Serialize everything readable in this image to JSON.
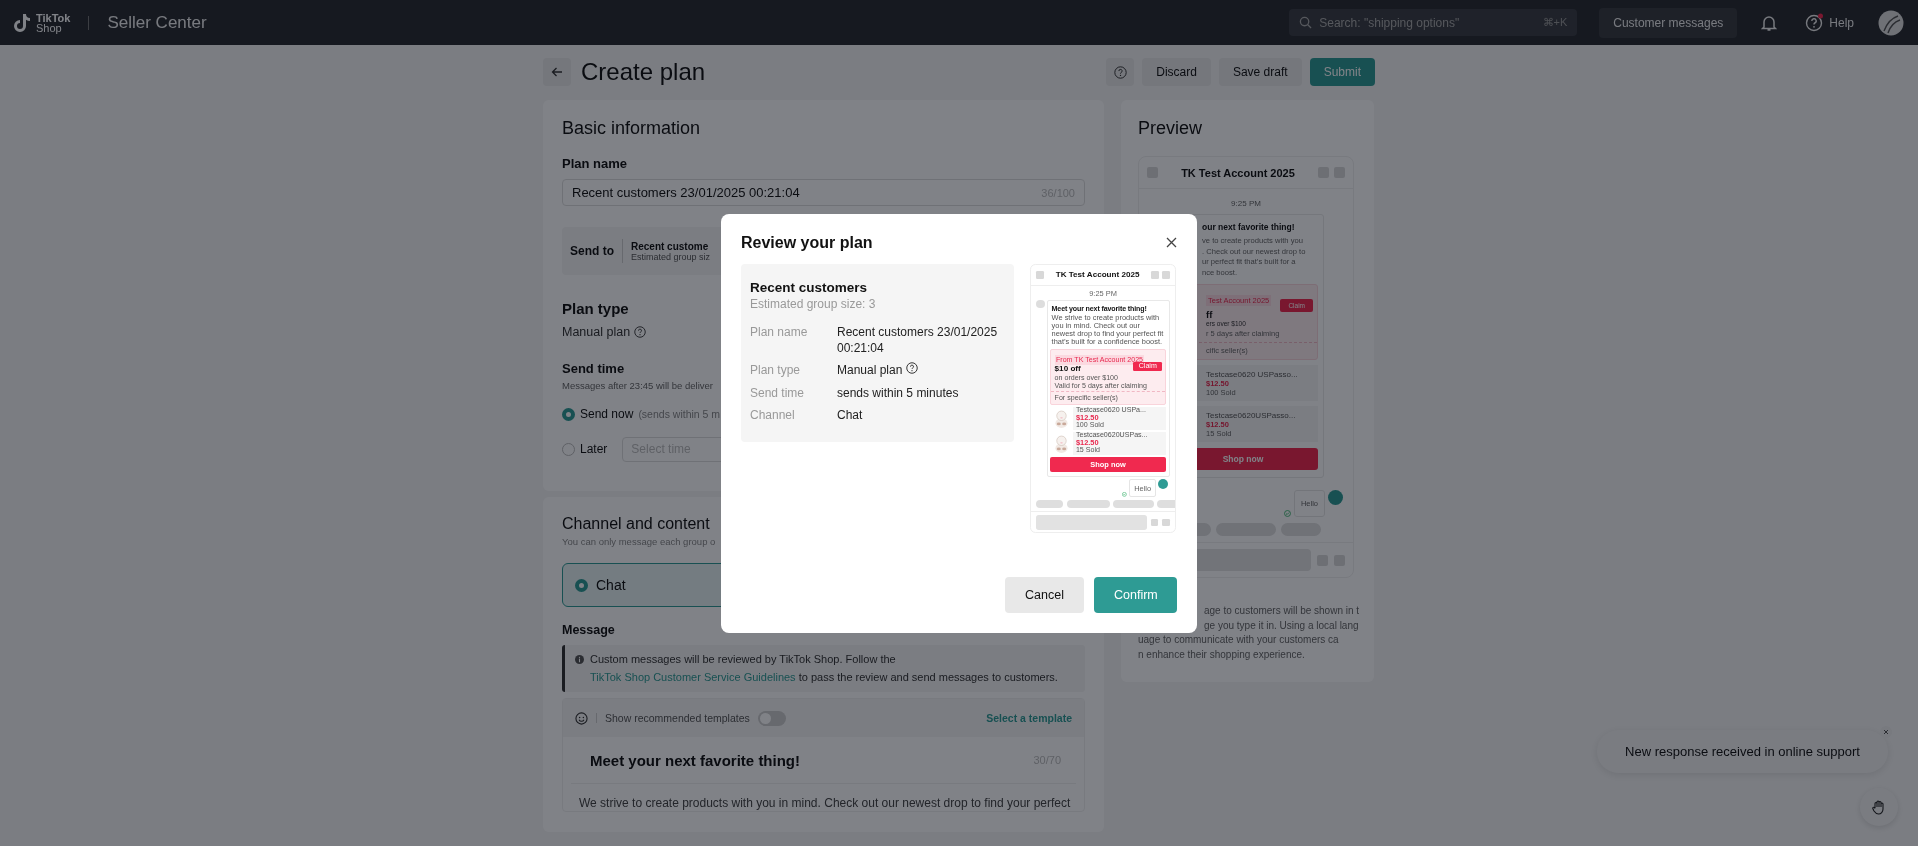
{
  "topbar": {
    "logo_line1": "TikTok",
    "logo_line2": "Shop",
    "title": "Seller Center",
    "search": {
      "placeholder": "Search: \"shipping options\"",
      "shortcut": "⌘+K"
    },
    "messages_button": "Customer messages",
    "help": "Help"
  },
  "page": {
    "title": "Create plan",
    "buttons": [
      {
        "label": "Discard",
        "kind": "secondary"
      },
      {
        "label": "Save draft",
        "kind": "secondary"
      },
      {
        "label": "Submit",
        "kind": "primary"
      }
    ]
  },
  "basic": {
    "title": "Basic information",
    "plan_name": {
      "label": "Plan name",
      "value": "Recent customers 23/01/2025 00:21:04",
      "counter": "36/100"
    },
    "send_to": {
      "label": "Send to",
      "group": "Recent custome",
      "size": "Estimated group siz"
    },
    "plan_type": {
      "title": "Plan type",
      "value": "Manual plan"
    },
    "send_time": {
      "title": "Send time",
      "note": "Messages after 23:45 will be deliver",
      "options": [
        {
          "label": "Send now",
          "hint": "(sends within 5 m",
          "selected": true
        },
        {
          "label": "Later",
          "placeholder": "Select time",
          "selected": false
        }
      ]
    }
  },
  "channel": {
    "title": "Channel and content",
    "subtitle": "You can only message each group o",
    "options": [
      {
        "label": "Chat",
        "selected": true
      }
    ],
    "message_label": "Message",
    "notice": "Custom messages will be reviewed by TikTok Shop. Follow the",
    "notice_link": "TikTok Shop Customer Service Guidelines",
    "notice_end": "to pass the review and send messages to customers.",
    "templates_label": "Show recommended templates",
    "templates_on": false,
    "select_template": "Select a template",
    "message_title": "Meet your next favorite thing!",
    "title_counter": "30/70",
    "body": "We strive to create products with you in mind. Check out our newest drop to find your perfect"
  },
  "preview": {
    "title": "Preview",
    "phone": {
      "header": "TK Test Account 2025",
      "time": "9:25 PM",
      "bubble_title": "our next favorite thing!",
      "body_lines": [
        "ve to create products with you",
        ". Check out our newest drop to",
        "ur perfect fit that’s built for a",
        "nce boost."
      ],
      "coupon": {
        "tag": "Test Account 2025",
        "amount": "ff",
        "condition": "ers over $100",
        "validity": "r 5 days after claiming",
        "scope": "cific seller(s)",
        "claim": "Claim"
      },
      "products": [
        {
          "name": "Testcase0620 USPasso...",
          "price": "$12.50",
          "sold": "100 Sold"
        },
        {
          "name": "Testcase0620USPasso...",
          "price": "$12.50",
          "sold": "15 Sold"
        }
      ],
      "cta": "Shop now",
      "reply": "Hello"
    },
    "note_lines": [
      "age to customers will be shown in t",
      "ge you type it in. Using a local lang",
      "uage to communicate with your customers ca",
      "n enhance their shopping experience."
    ]
  },
  "modal": {
    "title": "Review your plan",
    "group": "Recent customers",
    "size": "Estimated group size: 3",
    "rows": [
      {
        "label": "Plan name",
        "value": "Recent customers 23/01/2025 00:21:04",
        "kind": "text"
      },
      {
        "label": "Plan type",
        "value": "Manual plan",
        "kind": "help"
      },
      {
        "label": "Send time",
        "value": "sends within 5 minutes",
        "kind": "text"
      },
      {
        "label": "Channel",
        "value": "Chat",
        "kind": "text"
      }
    ],
    "phone": {
      "header": "TK Test Account 2025",
      "time": "9:25 PM",
      "bubble_title": "Meet your next favorite thing!",
      "body": "We strive to create products with you in mind. Check out our newest drop to find your perfect fit that’s built for a confidence boost.",
      "coupon": {
        "tag": "From TK Test Account 2025",
        "amount": "$10 off",
        "condition": "on orders over $100",
        "validity": "Valid for 5 days after claiming",
        "scope": "For specific seller(s)",
        "claim": "Claim"
      },
      "products": [
        {
          "name": "Testcase0620 USPa...",
          "price": "$12.50",
          "sold": "100 Sold"
        },
        {
          "name": "Testcase0620USPas...",
          "price": "$12.50",
          "sold": "15 Sold"
        }
      ],
      "cta": "Shop now",
      "reply": "Hello"
    },
    "buttons": [
      {
        "label": "Cancel",
        "kind": "secondary"
      },
      {
        "label": "Confirm",
        "kind": "primary"
      }
    ]
  },
  "toast": {
    "text": "New response received in online support"
  }
}
